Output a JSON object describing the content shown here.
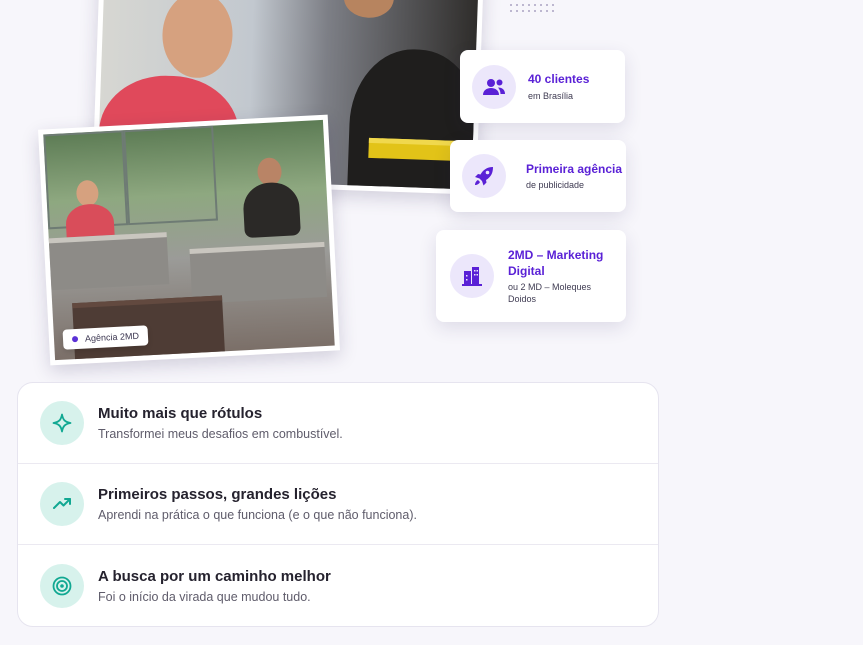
{
  "hero": {
    "photo_tag": "Agência 2MD",
    "stats": [
      {
        "icon": "users-icon",
        "title": "40 clientes",
        "subtitle": "em Brasília"
      },
      {
        "icon": "rocket-icon",
        "title": "Primeira agência",
        "subtitle": "de publicidade"
      },
      {
        "icon": "buildings-icon",
        "title": "2MD – Marketing Digital",
        "subtitle": "ou 2 MD – Moleques Doidos"
      }
    ]
  },
  "features": [
    {
      "icon": "sparkle-icon",
      "title": "Muito mais que rótulos",
      "description": "Transformei meus desafios em combustível."
    },
    {
      "icon": "trending-up-icon",
      "title": "Primeiros passos, grandes lições",
      "description": "Aprendi na prática o que funciona (e o que não funciona)."
    },
    {
      "icon": "target-icon",
      "title": "A busca por um caminho melhor",
      "description": "Foi o início da virada que mudou tudo."
    }
  ],
  "colors": {
    "accent": "#5a21d6",
    "icon_bg": "#ece7fb",
    "teal": "#11a892",
    "teal_bg": "#d7f2ec"
  }
}
